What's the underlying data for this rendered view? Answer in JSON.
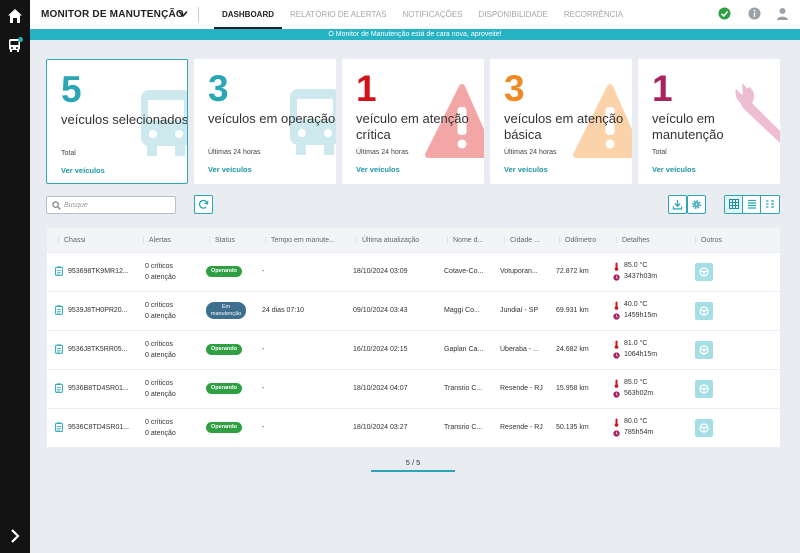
{
  "header": {
    "app_title": "MONITOR DE MANUTENÇÃO",
    "tabs": [
      {
        "label": "DASHBOARD",
        "active": true
      },
      {
        "label": "RELATÓRIO DE ALERTAS",
        "active": false
      },
      {
        "label": "NOTIFICAÇÕES",
        "active": false
      },
      {
        "label": "DISPONIBILIDADE",
        "active": false
      },
      {
        "label": "RECORRÊNCIA",
        "active": false
      }
    ]
  },
  "banner": "O Monitor de Manutenção está de cara nova, aproveite!",
  "cards": [
    {
      "number": "5",
      "label": "veículos selecionados",
      "sub": "Total",
      "link": "Ver veículos",
      "color": "#2aa6b5",
      "icon": "bus-icon"
    },
    {
      "number": "3",
      "label": "veículos em operação",
      "sub": "Últimas 24 horas",
      "link": "Ver veículos",
      "color": "#2aa6b5",
      "icon": "bus-icon"
    },
    {
      "number": "1",
      "label": "veículo em atenção crítica",
      "sub": "Últimas 24 horas",
      "link": "Ver veículos",
      "color": "#d0121b",
      "icon": "warning-icon"
    },
    {
      "number": "3",
      "label": "veículos em atenção básica",
      "sub": "Últimas 24 horas",
      "link": "Ver veículos",
      "color": "#f08a24",
      "icon": "warning-icon"
    },
    {
      "number": "1",
      "label": "veículo em manutenção",
      "sub": "Total",
      "link": "Ver veículos",
      "color": "#a8235f",
      "icon": "wrench-icon"
    }
  ],
  "search": {
    "placeholder": "Busque"
  },
  "table": {
    "columns": [
      "Chassi",
      "Alertas",
      "Status",
      "Tempo em manute...",
      "Última atualização",
      "Nome d...",
      "Cidade ...",
      "Odômetro",
      "Detalhes",
      "Outros"
    ],
    "rows": [
      {
        "chassi": "953698TK9MR12...",
        "criticos": "0 críticos",
        "atencao": "0 atenção",
        "status": "Operando",
        "status_type": "ok",
        "tempo": "-",
        "atualizacao": "18/10/2024 03:09",
        "nome": "Cotave-Co...",
        "cidade": "Votuporan...",
        "odometro": "72.872 km",
        "temp": "85.0 °C",
        "horas": "3437h03m"
      },
      {
        "chassi": "9539J8TH0PR20...",
        "criticos": "0 críticos",
        "atencao": "0 atenção",
        "status": "Em manutenção",
        "status_type": "maint",
        "tempo": "24 dias 07:10",
        "atualizacao": "09/10/2024 03:43",
        "nome": "Maggi Co...",
        "cidade": "Jundiaí - SP",
        "odometro": "69.931 km",
        "temp": "40.0 °C",
        "horas": "1459h15m"
      },
      {
        "chassi": "9536J8TK5RR05...",
        "criticos": "0 críticos",
        "atencao": "0 atenção",
        "status": "Operando",
        "status_type": "ok",
        "tempo": "-",
        "atualizacao": "16/10/2024 02:15",
        "nome": "Gaplan Ca...",
        "cidade": "Uberaba - ...",
        "odometro": "24.682 km",
        "temp": "81.0 °C",
        "horas": "1064h15m"
      },
      {
        "chassi": "9536B8TD4SR01...",
        "criticos": "0 críticos",
        "atencao": "0 atenção",
        "status": "Operando",
        "status_type": "ok",
        "tempo": "-",
        "atualizacao": "18/10/2024 04:07",
        "nome": "Transrio C...",
        "cidade": "Resende - RJ",
        "odometro": "15.958 km",
        "temp": "85.0 °C",
        "horas": "563h02m"
      },
      {
        "chassi": "9536C8TD4SR01...",
        "criticos": "0 críticos",
        "atencao": "0 atenção",
        "status": "Operando",
        "status_type": "ok",
        "tempo": "-",
        "atualizacao": "18/10/2024 03:27",
        "nome": "Transrio C...",
        "cidade": "Resende - RJ",
        "odometro": "50.135 km",
        "temp": "80.0 °C",
        "horas": "785h54m"
      }
    ]
  },
  "pagination": "5 / 5"
}
